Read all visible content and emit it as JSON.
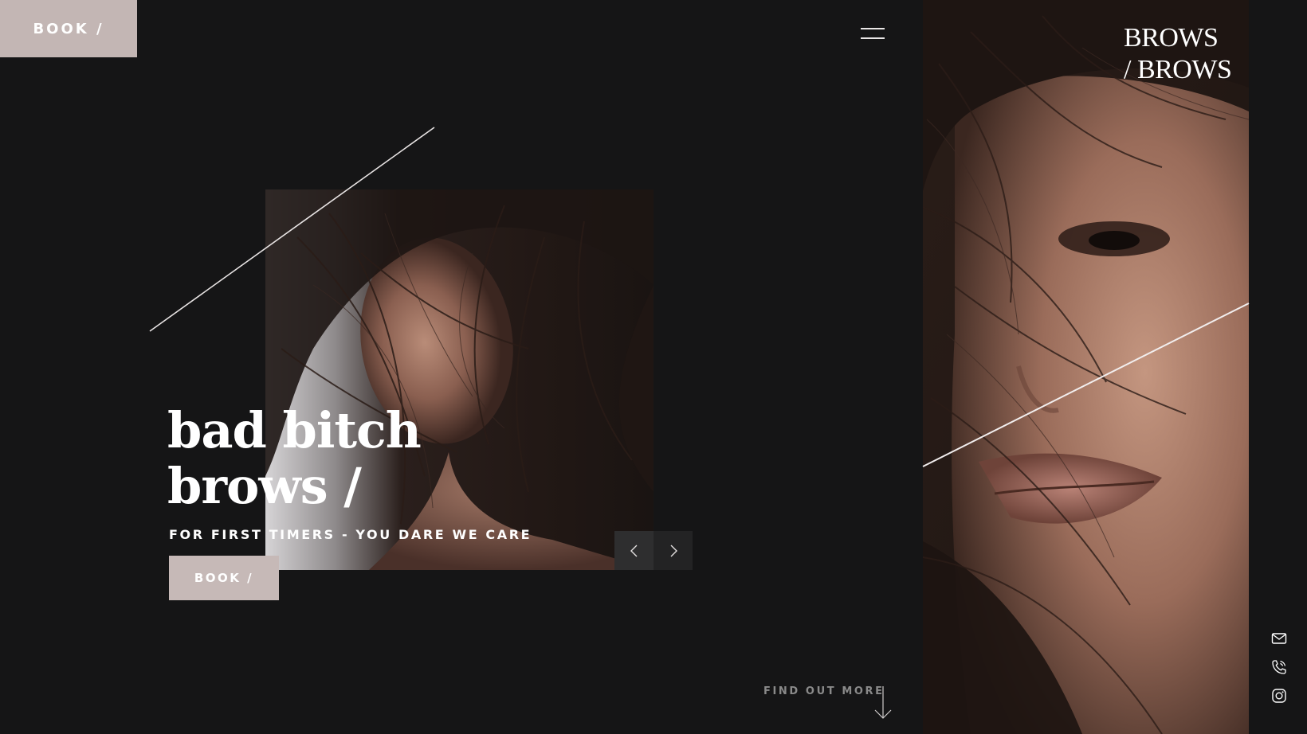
{
  "header": {
    "book_label": "BOOK /",
    "menu_icon": "hamburger-icon"
  },
  "brand": {
    "line1": "BROWS",
    "line2": "/ BROWS"
  },
  "hero": {
    "headline_line1": "bad bitch",
    "headline_line2": "brows /",
    "tagline": "FOR FIRST TIMERS - YOU DARE WE CARE",
    "book_label": "BOOK /",
    "prev_icon": "chevron-left-icon",
    "next_icon": "chevron-right-icon"
  },
  "footer": {
    "find_out_more": "FIND OUT MORE",
    "down_icon": "arrow-down-icon"
  },
  "social": {
    "icons": [
      "mail-icon",
      "phone-icon",
      "instagram-icon"
    ]
  },
  "colors": {
    "background": "#151516",
    "accent": "#c3b6b4",
    "text": "#ffffff",
    "muted": "#8a8a8a"
  }
}
